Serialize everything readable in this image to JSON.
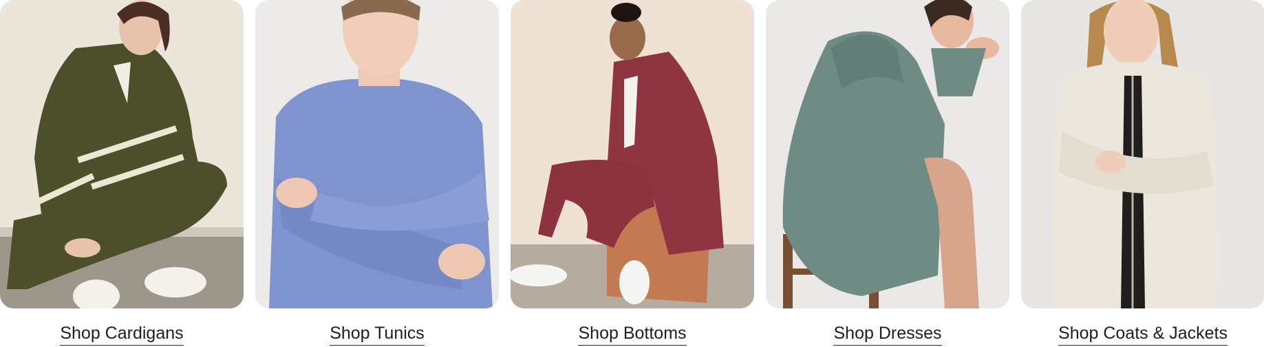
{
  "categories": [
    {
      "label": "Shop Cardigans",
      "photo_icon": "woman-in-olive-striped-cardigan-photo"
    },
    {
      "label": "Shop Tunics",
      "photo_icon": "woman-in-periwinkle-tunic-photo"
    },
    {
      "label": "Shop Bottoms",
      "photo_icon": "woman-in-burgundy-joggers-photo"
    },
    {
      "label": "Shop Dresses",
      "photo_icon": "woman-in-sage-hoodie-dress-photo"
    },
    {
      "label": "Shop Coats & Jackets",
      "photo_icon": "woman-in-cream-sherpa-jacket-photo"
    }
  ],
  "colors": {
    "cardigan": "#4b4f2a",
    "tunic": "#7f93cf",
    "bottoms": "#8d3340",
    "dress": "#6f8c84",
    "jacket": "#ece7dc"
  }
}
